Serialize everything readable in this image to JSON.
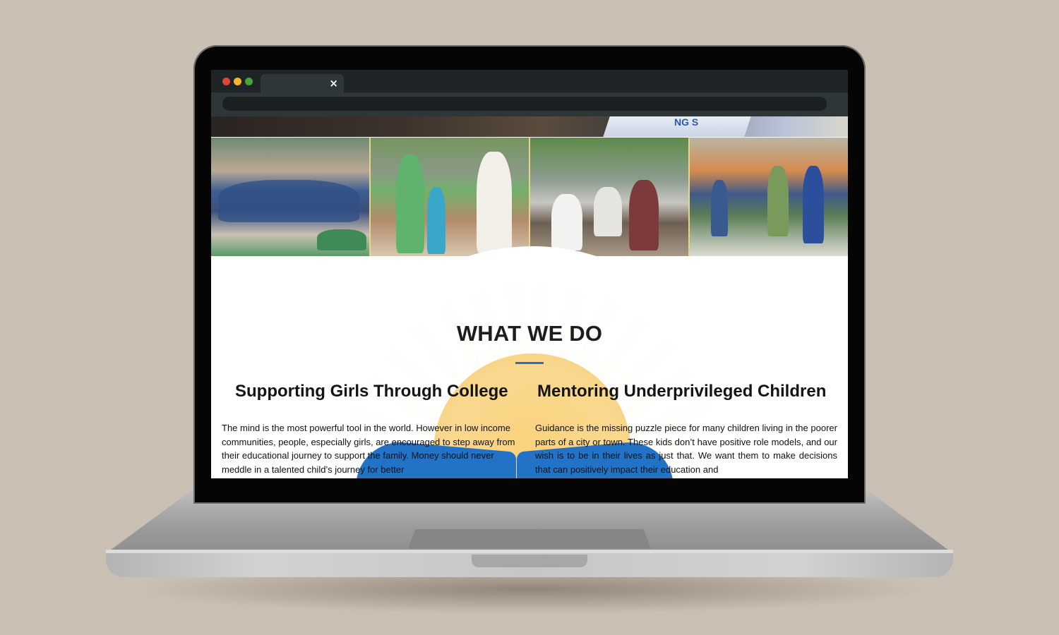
{
  "browser": {
    "tab_close": "×"
  },
  "hero": {
    "badge_text": "NG S"
  },
  "gallery": {
    "photos": [
      {
        "alt": "students seated in school courtyard"
      },
      {
        "alt": "distribution of supplies to family"
      },
      {
        "alt": "community members seated under tree"
      },
      {
        "alt": "award ceremony on stage"
      }
    ]
  },
  "section": {
    "title": "WHAT WE DO",
    "columns": [
      {
        "heading": "Supporting Girls Through College",
        "text": "The mind is the most powerful tool in the world. However in low income communities, people, especially girls, are encouraged to step away from their educational journey to support the family. Money should never meddle in a talented child’s journey for better"
      },
      {
        "heading": "Mentoring Underprivileged Children",
        "text": "Guidance is the missing puzzle piece for many children living in the poorer parts of a city or town. These kids don’t have positive role models, and our wish is to be in their lives as just that. We want them to make decisions that can positively impact their education and"
      }
    ]
  },
  "colors": {
    "accent_blue": "#2a6ebd",
    "sun_yellow": "#fbd27c",
    "book_blue": "#2272c6"
  }
}
